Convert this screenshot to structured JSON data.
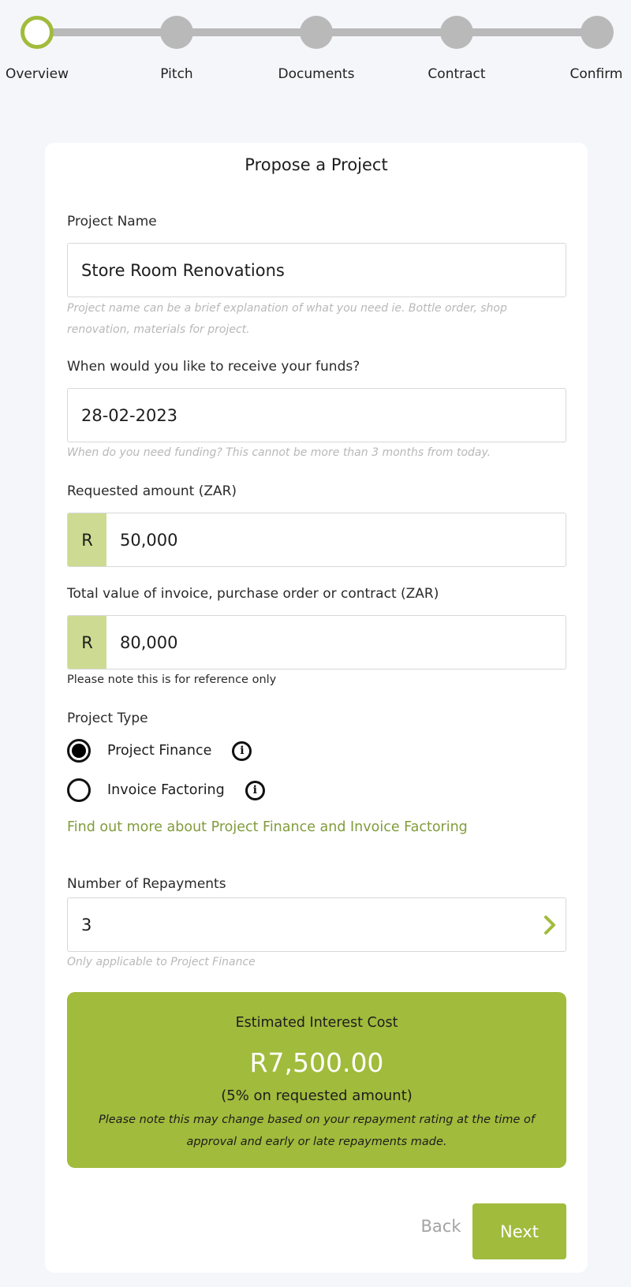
{
  "stepper": {
    "steps": [
      {
        "label": "Overview",
        "state": "active"
      },
      {
        "label": "Pitch",
        "state": "inactive"
      },
      {
        "label": "Documents",
        "state": "inactive"
      },
      {
        "label": "Contract",
        "state": "inactive"
      },
      {
        "label": "Confirm",
        "state": "inactive"
      }
    ]
  },
  "form": {
    "title": "Propose a Project",
    "project_name": {
      "label": "Project Name",
      "value": "Store Room Renovations",
      "hint": "Project name can be a brief explanation of what you need ie. Bottle order, shop renovation, materials for project."
    },
    "funds_date": {
      "label": "When would you like to receive your funds?",
      "value": "28-02-2023",
      "hint": "When do you need funding? This cannot be more than 3 months from today."
    },
    "requested_amount": {
      "label": "Requested amount (ZAR)",
      "prefix": "R",
      "value": "50,000"
    },
    "total_value": {
      "label": "Total value of invoice, purchase order or contract (ZAR)",
      "prefix": "R",
      "value": "80,000",
      "note": "Please note this is for reference only"
    },
    "project_type": {
      "label": "Project Type",
      "options": [
        {
          "label": "Project Finance",
          "selected": true,
          "icon": "info-icon"
        },
        {
          "label": "Invoice Factoring",
          "selected": false,
          "icon": "info-icon"
        }
      ],
      "link": "Find out more about Project Finance and Invoice Factoring"
    },
    "repayments": {
      "label": "Number of Repayments",
      "value": "3",
      "icon": "chevron-right-icon",
      "hint": "Only applicable to Project Finance"
    }
  },
  "estimate": {
    "title": "Estimated Interest Cost",
    "amount": "R7,500.00",
    "rate_text": "(5% on requested amount)",
    "note": "Please note this may change based on your repayment rating at the time of approval and early or late repayments made."
  },
  "actions": {
    "back_label": "Back",
    "next_label": "Next"
  },
  "colors": {
    "accent": "#a1bb3c",
    "prefix_bg": "#cddb92",
    "link": "#819c3c",
    "inactive_step": "#b9b9b9",
    "page_bg": "#f5f6fa"
  }
}
